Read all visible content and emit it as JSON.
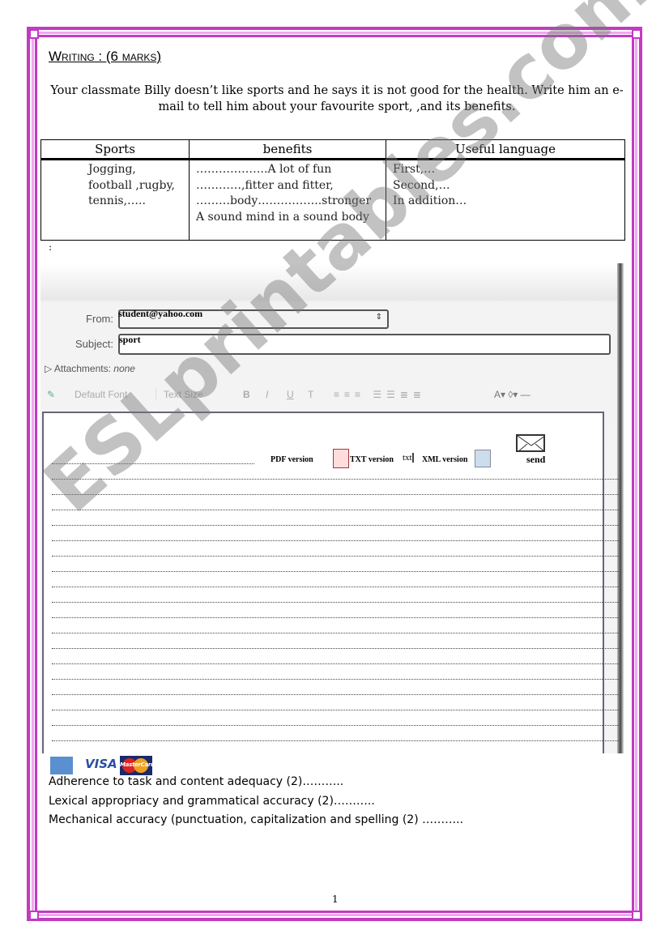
{
  "title": "Writing : (6 marks)",
  "instructions": "Your classmate Billy doesn’t like sports and he says it is not good for the health. Write him an e-mail to tell him about your favourite sport, ,and its benefits.",
  "table": {
    "headers": [
      "Sports",
      "benefits",
      "Useful language"
    ],
    "sports": [
      "Jogging,",
      "football ,rugby,",
      "tennis,….."
    ],
    "benefits": [
      "……………….A lot of fun",
      "…………,fitter and fitter,",
      "………body……………..stronger",
      "A sound mind in a sound body"
    ],
    "language": [
      "First,…",
      "Second,…",
      "In addition…"
    ]
  },
  "colon": ":",
  "email": {
    "from_label": "From:",
    "from_value": "student@yahoo.com",
    "subject_label": "Subject:",
    "subject_value": "sport",
    "attachments_label": "Attachments:",
    "attachments_value": "none",
    "font_select": "Default Font",
    "size_select": "Text Size",
    "format_buttons": [
      "B",
      "I",
      "U",
      "T"
    ],
    "pdf": "PDF version",
    "txt": "TXT version",
    "txt_icon": "txt",
    "xml": "XML version",
    "send": "send"
  },
  "watermark": "ESLprintables.com",
  "cards": {
    "visa": "VISA",
    "mastercard": "MasterCard"
  },
  "criteria": [
    "Adherence to task and content adequacy (2)………..",
    "Lexical appropriacy and grammatical accuracy (2)………..",
    "Mechanical accuracy (punctuation, capitalization and spelling (2) ……….."
  ],
  "page_number": "1",
  "colors": {
    "border": "#c23bc2",
    "border_light": "#f2a6f0"
  }
}
